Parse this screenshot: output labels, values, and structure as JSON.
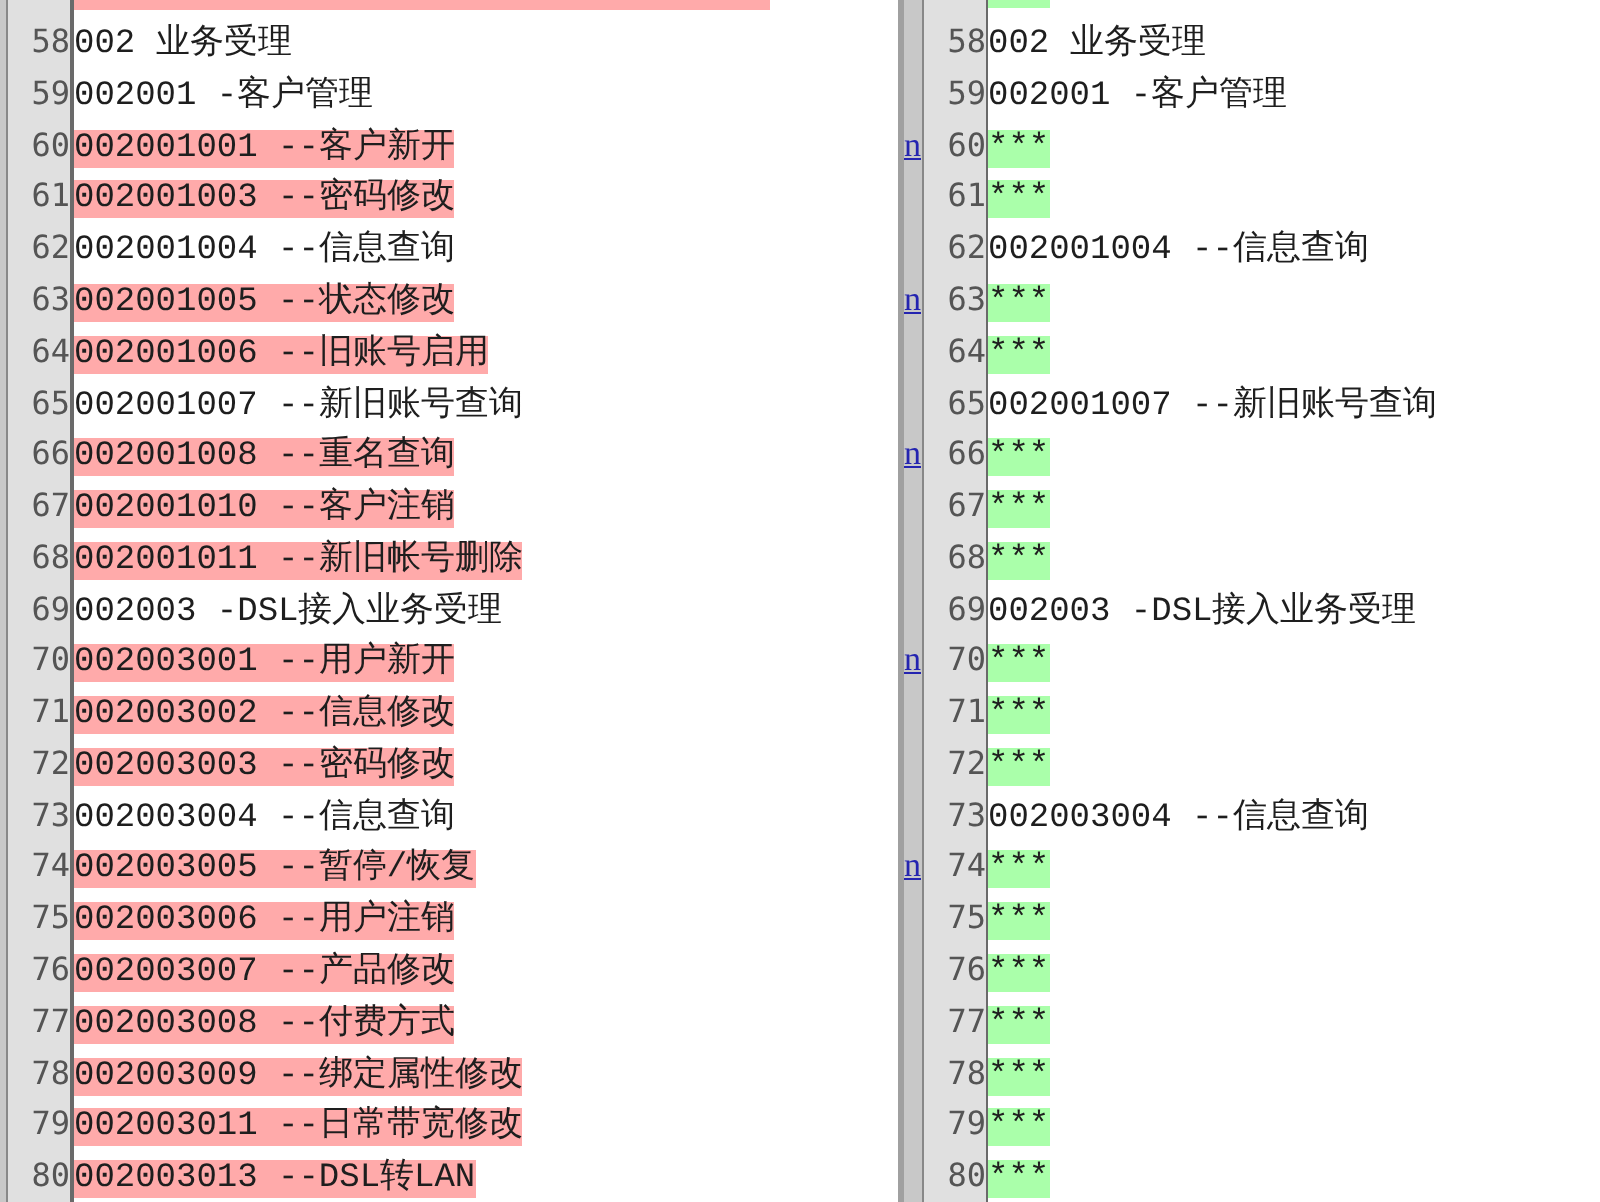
{
  "row_above_cut_off": {
    "left_deleted": true,
    "right_added": true
  },
  "rows": [
    {
      "left": {
        "number": "58",
        "text": "002 业务受理",
        "deleted": false
      },
      "right": {
        "number": "58",
        "text": "002 业务受理",
        "added": false
      }
    },
    {
      "left": {
        "number": "59",
        "text": "002001 -客户管理",
        "deleted": false
      },
      "right": {
        "number": "59",
        "text": "002001 -客户管理",
        "added": false
      }
    },
    {
      "left": {
        "number": "60",
        "text": "002001001 --客户新开",
        "deleted": true
      },
      "next_link": "n",
      "right": {
        "number": "60",
        "text": "***",
        "added": true
      }
    },
    {
      "left": {
        "number": "61",
        "text": "002001003 --密码修改",
        "deleted": true
      },
      "right": {
        "number": "61",
        "text": "***",
        "added": true
      }
    },
    {
      "left": {
        "number": "62",
        "text": "002001004 --信息查询",
        "deleted": false
      },
      "right": {
        "number": "62",
        "text": "002001004 --信息查询",
        "added": false
      }
    },
    {
      "left": {
        "number": "63",
        "text": "002001005 --状态修改",
        "deleted": true
      },
      "next_link": "n",
      "right": {
        "number": "63",
        "text": "***",
        "added": true
      }
    },
    {
      "left": {
        "number": "64",
        "text": "002001006 --旧账号启用",
        "deleted": true
      },
      "right": {
        "number": "64",
        "text": "***",
        "added": true
      }
    },
    {
      "left": {
        "number": "65",
        "text": "002001007 --新旧账号查询",
        "deleted": false
      },
      "right": {
        "number": "65",
        "text": "002001007 --新旧账号查询",
        "added": false
      }
    },
    {
      "left": {
        "number": "66",
        "text": "002001008 --重名查询",
        "deleted": true
      },
      "next_link": "n",
      "right": {
        "number": "66",
        "text": "***",
        "added": true
      }
    },
    {
      "left": {
        "number": "67",
        "text": "002001010 --客户注销",
        "deleted": true
      },
      "right": {
        "number": "67",
        "text": "***",
        "added": true
      }
    },
    {
      "left": {
        "number": "68",
        "text": "002001011 --新旧帐号删除",
        "deleted": true
      },
      "right": {
        "number": "68",
        "text": "***",
        "added": true
      }
    },
    {
      "left": {
        "number": "69",
        "text": "002003 -DSL接入业务受理",
        "deleted": false
      },
      "right": {
        "number": "69",
        "text": "002003 -DSL接入业务受理",
        "added": false
      }
    },
    {
      "left": {
        "number": "70",
        "text": "002003001 --用户新开",
        "deleted": true
      },
      "next_link": "n",
      "right": {
        "number": "70",
        "text": "***",
        "added": true
      }
    },
    {
      "left": {
        "number": "71",
        "text": "002003002 --信息修改",
        "deleted": true
      },
      "right": {
        "number": "71",
        "text": "***",
        "added": true
      }
    },
    {
      "left": {
        "number": "72",
        "text": "002003003 --密码修改",
        "deleted": true
      },
      "right": {
        "number": "72",
        "text": "***",
        "added": true
      }
    },
    {
      "left": {
        "number": "73",
        "text": "002003004 --信息查询",
        "deleted": false
      },
      "right": {
        "number": "73",
        "text": "002003004 --信息查询",
        "added": false
      }
    },
    {
      "left": {
        "number": "74",
        "text": "002003005 --暂停/恢复",
        "deleted": true
      },
      "next_link": "n",
      "right": {
        "number": "74",
        "text": "***",
        "added": true
      }
    },
    {
      "left": {
        "number": "75",
        "text": "002003006 --用户注销",
        "deleted": true
      },
      "right": {
        "number": "75",
        "text": "***",
        "added": true
      }
    },
    {
      "left": {
        "number": "76",
        "text": "002003007 --产品修改",
        "deleted": true
      },
      "right": {
        "number": "76",
        "text": "***",
        "added": true
      }
    },
    {
      "left": {
        "number": "77",
        "text": "002003008 --付费方式",
        "deleted": true
      },
      "right": {
        "number": "77",
        "text": "***",
        "added": true
      }
    },
    {
      "left": {
        "number": "78",
        "text": "002003009 --绑定属性修改",
        "deleted": true
      },
      "right": {
        "number": "78",
        "text": "***",
        "added": true
      }
    },
    {
      "left": {
        "number": "79",
        "text": "002003011 --日常带宽修改",
        "deleted": true
      },
      "right": {
        "number": "79",
        "text": "***",
        "added": true
      }
    },
    {
      "left": {
        "number": "80",
        "text": "002003013 --DSL转LAN",
        "deleted": true
      },
      "right": {
        "number": "80",
        "text": "***",
        "added": true
      }
    }
  ]
}
